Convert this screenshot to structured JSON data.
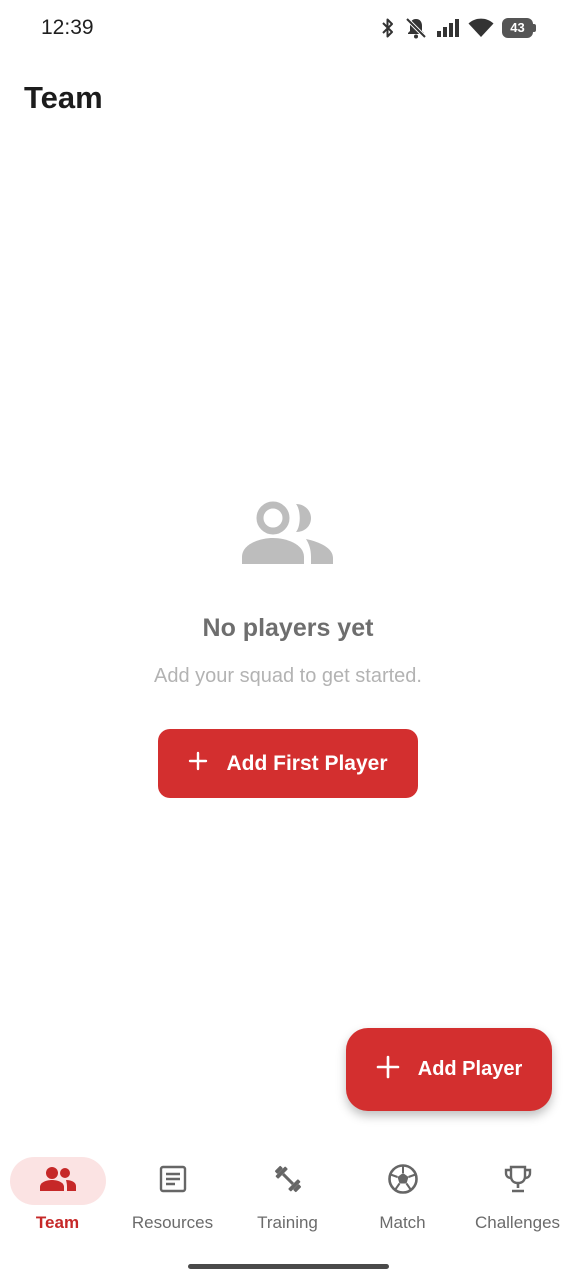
{
  "status_bar": {
    "time": "12:39",
    "battery_level": "43",
    "icons": [
      "bluetooth-icon",
      "notifications-off-icon",
      "signal-icon",
      "wifi-icon",
      "battery-icon"
    ]
  },
  "app_bar": {
    "title": "Team"
  },
  "empty_state": {
    "icon": "group-icon",
    "title": "No players yet",
    "subtitle": "Add your squad to get started.",
    "button_label": "Add First Player"
  },
  "fab": {
    "label": "Add Player",
    "icon": "plus-icon"
  },
  "bottom_nav": {
    "items": [
      {
        "label": "Team",
        "icon": "group-icon",
        "active": true
      },
      {
        "label": "Resources",
        "icon": "article-icon",
        "active": false
      },
      {
        "label": "Training",
        "icon": "dumbbell-icon",
        "active": false
      },
      {
        "label": "Match",
        "icon": "soccer-ball-icon",
        "active": false
      },
      {
        "label": "Challenges",
        "icon": "trophy-icon",
        "active": false
      }
    ]
  },
  "colors": {
    "accent": "#d32f2f",
    "active_pill": "#fbe3e3",
    "active_label": "#c62828",
    "inactive": "#6b6b6b",
    "empty_icon": "#bdbdbd"
  }
}
